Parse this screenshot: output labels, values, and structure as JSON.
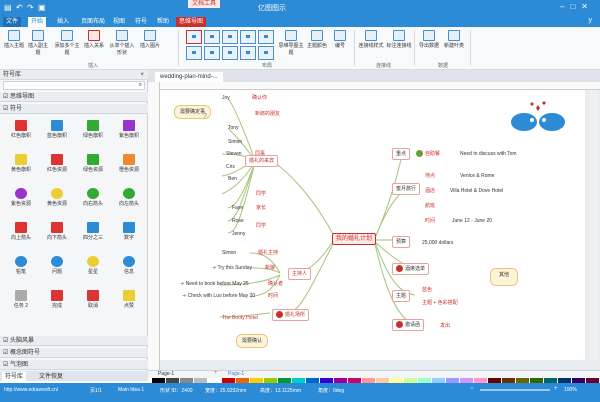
{
  "titlebar": {
    "app_title": "亿图图示",
    "context_tab": "文档工具",
    "help_symbol": "y"
  },
  "tabs": [
    "文件",
    "开始",
    "插入",
    "页面布局",
    "视图",
    "符号",
    "帮助",
    "思维导图"
  ],
  "ribbon": {
    "buttons": [
      "插入主题",
      "插入副主题",
      "添加多个主题",
      "插入关系",
      "从单个插入形状",
      "插入图片"
    ],
    "more_buttons": [
      "思维导图主题",
      "主题颜色",
      "编号",
      "连接线样式",
      "标注连接线",
      "导出数据",
      "新建叶类"
    ],
    "groups": [
      "插入",
      "布局",
      "连接线",
      "数据"
    ]
  },
  "left_panel": {
    "title": "符号库",
    "sections": [
      "思维导图",
      "符号"
    ],
    "symbols": [
      "红色旗帜",
      "蓝色旗帜",
      "绿色旗帜",
      "紫色旗帜",
      "黄色旗帜",
      "红色资源",
      "绿色资源",
      "橙色资源",
      "紫色资源",
      "黄色资源",
      "向右箭头",
      "向左箭头",
      "向上箭头",
      "向下箭头",
      "四分之三",
      "数字",
      "铅笔",
      "问题",
      "星星",
      "信息",
      "任务 2",
      "完成",
      "取消",
      "点赞"
    ],
    "bottom_sections": [
      "头脑风暴",
      "概念图符号",
      "气泡图"
    ],
    "bottom_tabs": [
      "符号库",
      "文件恢复"
    ]
  },
  "doc_tab": "wedding-plan-mind-...",
  "mindmap": {
    "center": "我的婚礼计划",
    "left_top_cloud": "需要确定事",
    "left_bottom_cloud": "需要确认",
    "branch_guests": "婚礼的来宾",
    "guests": [
      "Joy",
      "Tony",
      "Simon",
      "Steven",
      "Cris",
      "Ben",
      "Faye",
      "Rose",
      "Jenny"
    ],
    "guest_notes": [
      "确认你",
      "新郎的朋友",
      "同事",
      "同学",
      "家长",
      "同学",
      "同事",
      "朋友"
    ],
    "branch_host": "主持人",
    "host_items": [
      "Simon",
      "Try this Sunday",
      "Need to book before May 25",
      "Check with Luo before May 20"
    ],
    "host_notes": [
      "婚礼主持",
      "新娘",
      "确认者",
      "时间",
      "备忘"
    ],
    "branch_venue": "婚礼场所",
    "venue_item": "The Booty Hotel",
    "right_items": [
      "重点",
      "蜜月旅行",
      "预算",
      "酒席选单",
      "主题",
      "邀请函"
    ],
    "right_notes": [
      "Need to discuss with Tom",
      "Venice & Rome",
      "Villa Hotel & Dove Hotel",
      "June 12 - June 20",
      "25,000 dollars",
      "婚纱照",
      "邀请名单"
    ],
    "right_labels": [
      "自助餐",
      "地点",
      "酒店",
      "航班",
      "时间",
      "蓝色",
      "花卉",
      "主题 + 色彩搭配",
      "发出"
    ],
    "right_cloud": "其他"
  },
  "page_tabs": [
    "Page-1",
    "+",
    "Page-1"
  ],
  "statusbar": {
    "url": "http://www.edrawsoft.cn/",
    "page": "页1/1",
    "shape": "Main Idea 1",
    "shape_id": "形状 ID：2400",
    "width": "宽度：25.9292mm",
    "height": "高度：13.1125mm",
    "angle": "角度：0deg",
    "zoom": "100%"
  },
  "colors": {
    "title_blue": "#2c8bd6",
    "accent_red": "#c9302c",
    "branch_green": "#6a9a3a",
    "cloud_fill": "#fdf3d9"
  }
}
